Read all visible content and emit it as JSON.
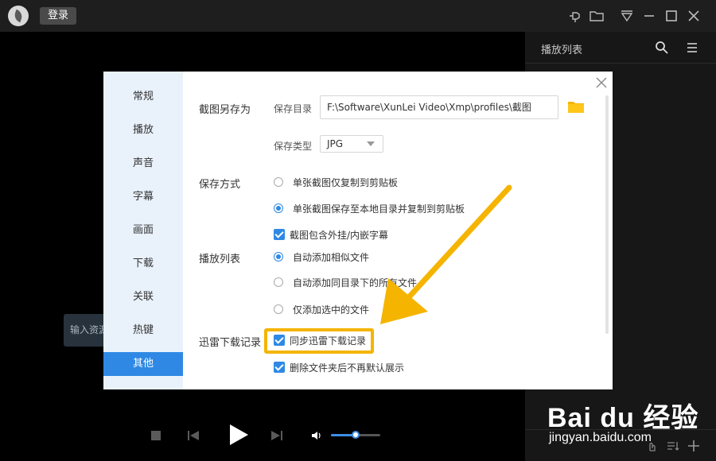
{
  "titlebar": {
    "login_label": "登录",
    "icons": [
      "pin-icon",
      "folder-icon",
      "dropdown-icon",
      "minimize-icon",
      "maximize-icon",
      "close-icon"
    ]
  },
  "playlist": {
    "title": "播放列表",
    "icons": [
      "search-icon",
      "menu-icon",
      "hand-icon",
      "sort-icon",
      "add-icon"
    ]
  },
  "video": {
    "input_hint": "输入资源"
  },
  "controls": {
    "volume_level": 0.5
  },
  "dialog": {
    "nav": [
      "常规",
      "播放",
      "声音",
      "字幕",
      "画面",
      "下载",
      "关联",
      "热键",
      "其他"
    ],
    "active_nav": "其他",
    "screenshot": {
      "section": "截图另存为",
      "dir_label": "保存目录",
      "dir_value": "F:\\Software\\XunLei Video\\Xmp\\profiles\\截图",
      "type_label": "保存类型",
      "type_value": "JPG"
    },
    "save_mode": {
      "section": "保存方式",
      "options": [
        "单张截图仅复制到剪贴板",
        "单张截图保存至本地目录并复制到剪贴板"
      ],
      "selected_index": 1,
      "checkbox_label": "截图包含外挂/内嵌字幕",
      "checkbox_checked": true
    },
    "playlist_section": {
      "section": "播放列表",
      "options": [
        "自动添加相似文件",
        "自动添加同目录下的所有文件",
        "仅添加选中的文件"
      ],
      "selected_index": 0
    },
    "xunlei": {
      "section": "迅雷下载记录",
      "sync_label": "同步迅雷下载记录",
      "sync_checked": true,
      "delete_label": "删除文件夹后不再默认展示",
      "delete_checked": true
    }
  },
  "watermark": {
    "main": "Bai du 经验",
    "sub": "jingyan.baidu.com"
  },
  "colors": {
    "accent": "#2f89e4",
    "highlight": "#f5b400",
    "nav_bg": "#e9f1fb"
  }
}
